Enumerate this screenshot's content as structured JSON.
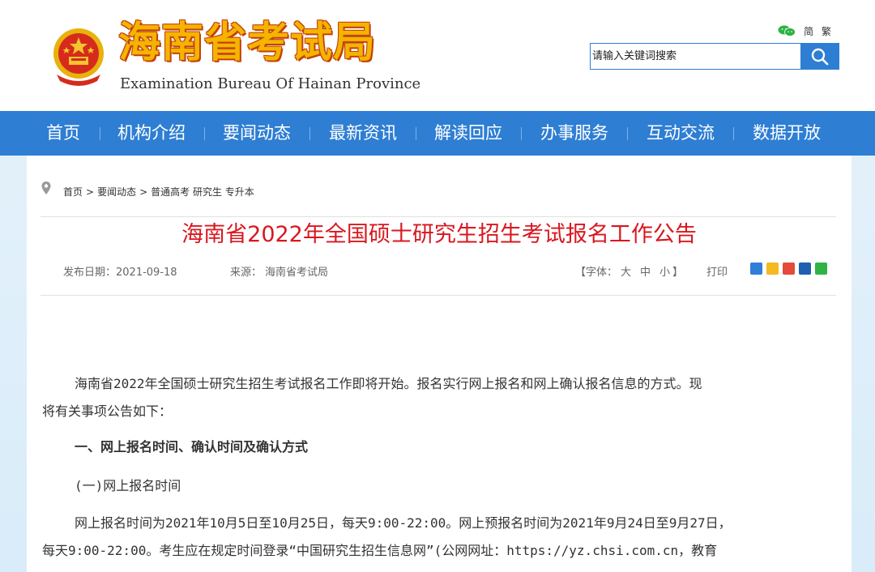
{
  "header": {
    "title": "海南省考试局",
    "subtitle": "Examination Bureau Of Hainan Province",
    "lang_simplified": "简",
    "lang_traditional": "繁",
    "search_placeholder": "请输入关键词搜索"
  },
  "nav": {
    "items": [
      "首页",
      "机构介绍",
      "要闻动态",
      "最新资讯",
      "解读回应",
      "办事服务",
      "互动交流",
      "数据开放"
    ]
  },
  "breadcrumb": {
    "items": [
      "首页",
      "要闻动态",
      "普通高考 研究生 专升本"
    ],
    "separator": ">"
  },
  "article": {
    "title": "海南省2022年全国硕士研究生招生考试报名工作公告",
    "date_label": "发布日期：2021-09-18",
    "source_label": "来源：",
    "source": "海南省考试局",
    "font_label": "【字体：",
    "font_large": "大",
    "font_medium": "中",
    "font_small": "小",
    "font_close": "】",
    "print_label": "打印",
    "paragraphs": [
      "海南省2022年全国硕士研究生招生考试报名工作即将开始。报名实行网上报名和网上确认报名信息的方式。现",
      "将有关事项公告如下：",
      "一、网上报名时间、确认时间及确认方式",
      "(一)网上报名时间",
      "网上报名时间为2021年10月5日至10月25日，每天9:00-22:00。网上预报名时间为2021年9月24日至9月27日，",
      "每天9:00-22:00。考生应在规定时间登录“中国研究生招生信息网”(公网网址：https://yz.chsi.com.cn，教育"
    ]
  },
  "colors": {
    "nav_blue": "#2e7ed3",
    "title_red": "#d9171f",
    "logo_gold": "#f4b400"
  }
}
